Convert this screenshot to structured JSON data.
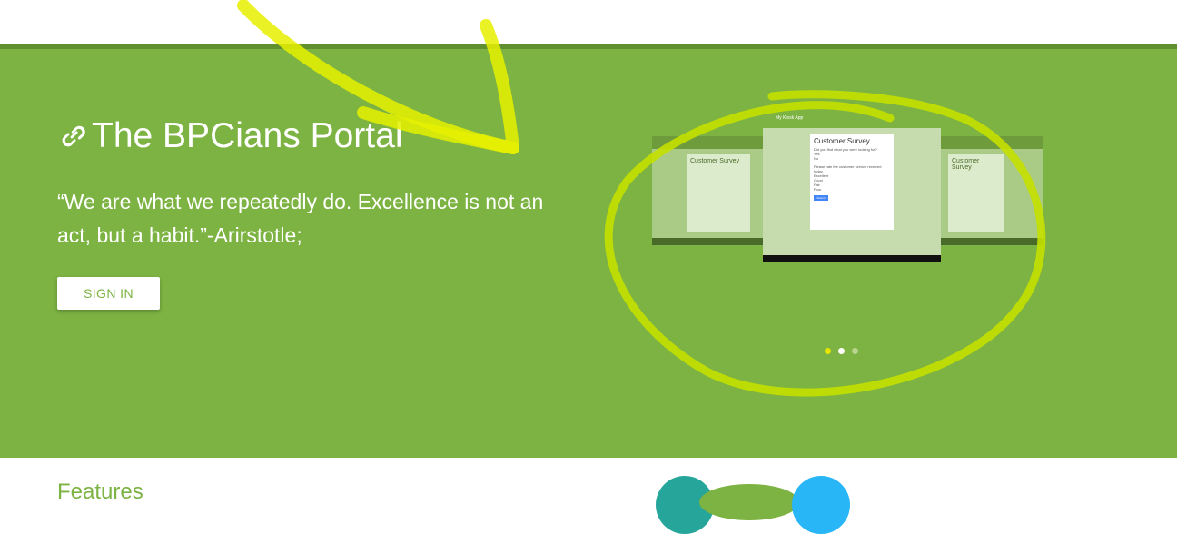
{
  "hero": {
    "title": "The BPCians Portal",
    "quote": "“We are what we repeatedly do. Excellence is not an act, but a habit.”-Arirstotle;",
    "signin_label": "SIGN IN"
  },
  "carousel": {
    "app_title": "My Kiosk App",
    "survey_title": "Customer Survey",
    "question1": "Did you find what you were looking for?",
    "question2": "Please rate the customer service received today.",
    "options1": [
      "Yes",
      "No"
    ],
    "options2": [
      "Excellent",
      "Good",
      "Fair",
      "Poor"
    ],
    "submit": "Submit",
    "dot_count": 3,
    "active_dot": 1
  },
  "features": {
    "heading": "Features"
  },
  "colors": {
    "hero_bg": "#7cb342",
    "accent": "#7cb342",
    "annotation": "#e6f000",
    "teal": "#26a69a",
    "blue": "#29b6f6"
  },
  "icons": [
    "link-icon"
  ]
}
